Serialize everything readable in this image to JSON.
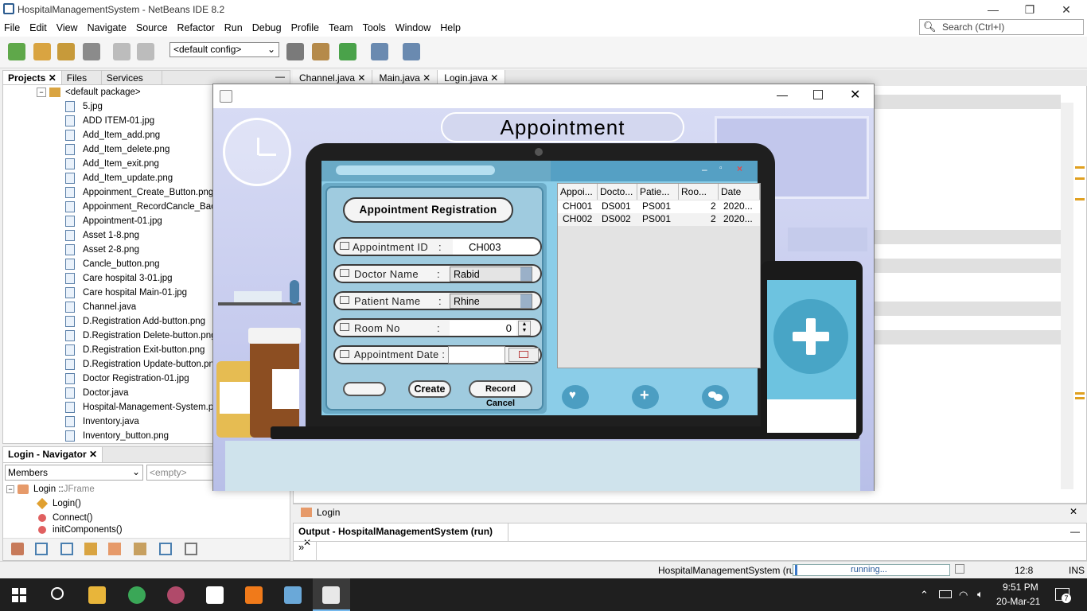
{
  "netbeans": {
    "window_title": "HospitalManagementSystem - NetBeans IDE 8.2",
    "menu": [
      "File",
      "Edit",
      "View",
      "Navigate",
      "Source",
      "Refactor",
      "Run",
      "Debug",
      "Profile",
      "Team",
      "Tools",
      "Window",
      "Help"
    ],
    "search_placeholder": "Search (Ctrl+I)",
    "config_select": "<default config>",
    "left_tabs": [
      "Projects",
      "Files",
      "Services"
    ],
    "package_node": "<default package>",
    "files": [
      "5.jpg",
      "ADD ITEM-01.jpg",
      "Add_Item_add.png",
      "Add_Item_delete.png",
      "Add_Item_exit.png",
      "Add_Item_update.png",
      "Appoinment_Create_Button.png",
      "Appoinment_RecordCancle_Back B",
      "Appointment-01.jpg",
      "Asset 1-8.png",
      "Asset 2-8.png",
      "Cancle_button.png",
      "Care hospital 3-01.jpg",
      "Care hospital Main-01.jpg",
      "Channel.java",
      "D.Registration Add-button.png",
      "D.Registration Delete-button.png",
      "D.Registration Exit-button.png",
      "D.Registration Update-button.png",
      "Doctor Registration-01.jpg",
      "Doctor.java",
      "Hospital-Management-System.png",
      "Inventory.java",
      "Inventory_button.png"
    ],
    "navigator_title": "Login - Navigator",
    "navigator_members": "Members",
    "navigator_empty": "<empty>",
    "navigator_tree": {
      "root": "Login :: ",
      "root_type": "JFrame",
      "children": [
        "Login()",
        "Connect()",
        "initComponents()"
      ]
    },
    "editor_tabs": [
      "Channel.java",
      "Main.java",
      "Login.java"
    ],
    "breadcrumb": "Login",
    "output_title": "Output - HospitalManagementSystem (run)",
    "output_prompt": "»",
    "status_project": "HospitalManagementSystem (run)",
    "status_progress": "running...",
    "cursor_pos": "12:8",
    "ins_mode": "INS"
  },
  "appointment_window": {
    "banner": "Appointment",
    "form_title": "Appointment Registration",
    "fields": {
      "appointment_id_label": "Appointment ID",
      "appointment_id_sep": ":",
      "appointment_id_value": "CH003",
      "doctor_name_label": "Doctor Name",
      "doctor_name_sep": ":",
      "doctor_name_value": "Rabid",
      "patient_name_label": "Patient Name",
      "patient_name_sep": ":",
      "patient_name_value": "Rhine",
      "room_no_label": "Room No",
      "room_no_sep": ":",
      "room_no_value": "0",
      "appointment_date_label": "Appointment Date :"
    },
    "buttons": {
      "create": "Create",
      "record_cancel": "Record Cancel"
    },
    "table": {
      "columns": [
        "Appoi...",
        "Docto...",
        "Patie...",
        "Roo...",
        "Date"
      ],
      "rows": [
        [
          "CH001",
          "DS001",
          "PS001",
          "2",
          "2020..."
        ],
        [
          "CH002",
          "DS002",
          "PS001",
          "2",
          "2020..."
        ]
      ]
    }
  },
  "taskbar": {
    "time": "9:51 PM",
    "date": "20-Mar-21",
    "notification_count": "7"
  }
}
